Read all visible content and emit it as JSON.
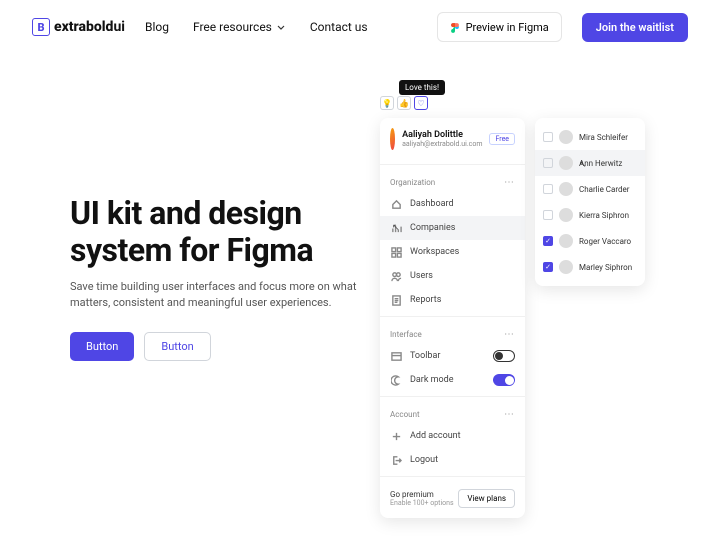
{
  "header": {
    "brand_bold": "extrabold",
    "brand_light": "ui",
    "nav": [
      "Blog",
      "Free resources",
      "Contact us"
    ],
    "preview": "Preview in Figma",
    "waitlist": "Join the waitlist"
  },
  "hero": {
    "title": "UI kit and design system for Figma",
    "subtitle": "Save time building user interfaces and focus more on what matters, consistent and meaningful user experiences.",
    "btn_filled": "Button",
    "btn_outlined": "Button"
  },
  "mock": {
    "tooltip": "Love this!",
    "user": {
      "name": "Aaliyah Dolittle",
      "email": "aaliyah@extrabold.ui.com",
      "badge": "Free"
    },
    "sections": {
      "org": "Organization",
      "interface": "Interface",
      "account": "Account"
    },
    "items": {
      "dashboard": "Dashboard",
      "companies": "Companies",
      "workspaces": "Workspaces",
      "users": "Users",
      "reports": "Reports",
      "toolbar": "Toolbar",
      "darkmode": "Dark mode",
      "addaccount": "Add account",
      "logout": "Logout"
    },
    "premium": {
      "title": "Go premium",
      "sub": "Enable 100+ options",
      "btn": "View plans"
    },
    "people": [
      "Mira Schleifer",
      "Ann Herwitz",
      "Charlie Carder",
      "Kierra Siphron",
      "Roger Vaccaro",
      "Marley Siphron"
    ]
  }
}
